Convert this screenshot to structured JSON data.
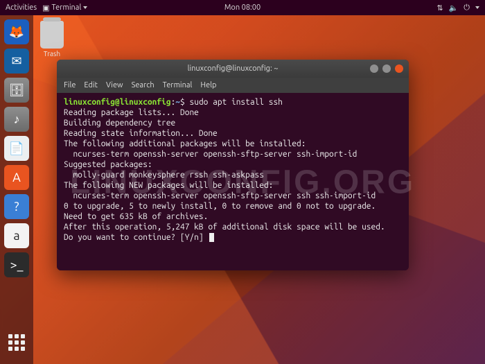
{
  "topbar": {
    "activities": "Activities",
    "app_label": "Terminal",
    "clock": "Mon 08:00"
  },
  "desktop": {
    "trash_label": "Trash"
  },
  "dock": {
    "items": [
      {
        "name": "firefox",
        "glyph": "🦊"
      },
      {
        "name": "thunderbird",
        "glyph": "✉"
      },
      {
        "name": "files",
        "glyph": "🗄"
      },
      {
        "name": "rhythmbox",
        "glyph": "♪"
      },
      {
        "name": "writer",
        "glyph": "📄"
      },
      {
        "name": "software",
        "glyph": "A"
      },
      {
        "name": "help",
        "glyph": "?"
      },
      {
        "name": "amazon",
        "glyph": "a"
      },
      {
        "name": "terminal",
        "glyph": ">_"
      }
    ]
  },
  "window": {
    "title": "linuxconfig@linuxconfig: ~",
    "menu": [
      "File",
      "Edit",
      "View",
      "Search",
      "Terminal",
      "Help"
    ]
  },
  "terminal": {
    "prompt_user": "linuxconfig@linuxconfig",
    "prompt_sep": ":",
    "prompt_path": "~",
    "prompt_end": "$",
    "command": "sudo apt install ssh",
    "lines": [
      "Reading package lists... Done",
      "Building dependency tree",
      "Reading state information... Done",
      "The following additional packages will be installed:",
      "  ncurses-term openssh-server openssh-sftp-server ssh-import-id",
      "Suggested packages:",
      "  molly-guard monkeysphere rssh ssh-askpass",
      "The following NEW packages will be installed:",
      "  ncurses-term openssh-server openssh-sftp-server ssh ssh-import-id",
      "0 to upgrade, 5 to newly install, 0 to remove and 0 not to upgrade.",
      "Need to get 635 kB of archives.",
      "After this operation, 5,247 kB of additional disk space will be used.",
      "Do you want to continue? [Y/n] "
    ]
  },
  "watermark": "LINUXCONFIG.ORG"
}
